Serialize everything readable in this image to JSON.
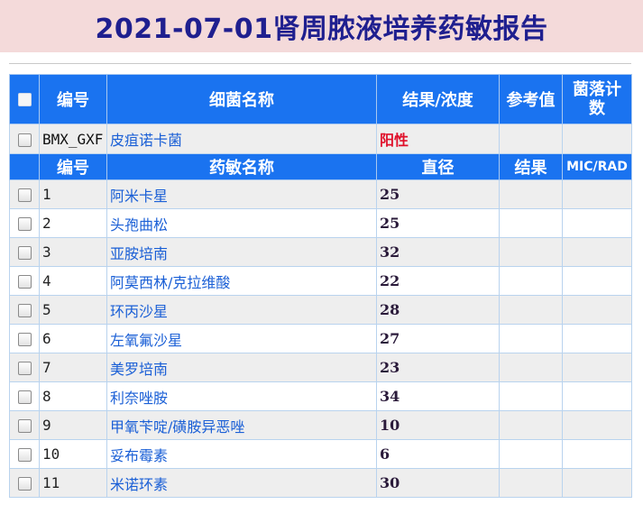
{
  "title": "2021-07-01肾周脓液培养药敏报告",
  "header": {
    "no": "编号",
    "bacteria_name": "细菌名称",
    "result_conc": "结果/浓度",
    "reference": "参考值",
    "colony_count": "菌落计数"
  },
  "bacteria": {
    "code": "BMX_GXF",
    "name": "皮疽诺卡菌",
    "result": "阳性"
  },
  "subheader": {
    "no": "编号",
    "drug_name": "药敏名称",
    "diameter": "直径",
    "result": "结果",
    "mic": "MIC/RAD"
  },
  "drugs": [
    {
      "no": "1",
      "name": "阿米卡星",
      "diameter": "25",
      "result": "",
      "mic": ""
    },
    {
      "no": "2",
      "name": "头孢曲松",
      "diameter": "25",
      "result": "",
      "mic": ""
    },
    {
      "no": "3",
      "name": "亚胺培南",
      "diameter": "32",
      "result": "",
      "mic": ""
    },
    {
      "no": "4",
      "name": "阿莫西林/克拉维酸",
      "diameter": "22",
      "result": "",
      "mic": ""
    },
    {
      "no": "5",
      "name": "环丙沙星",
      "diameter": "28",
      "result": "",
      "mic": ""
    },
    {
      "no": "6",
      "name": "左氧氟沙星",
      "diameter": "27",
      "result": "",
      "mic": ""
    },
    {
      "no": "7",
      "name": "美罗培南",
      "diameter": "23",
      "result": "",
      "mic": ""
    },
    {
      "no": "8",
      "name": "利奈唑胺",
      "diameter": "34",
      "result": "",
      "mic": ""
    },
    {
      "no": "9",
      "name": "甲氧苄啶/磺胺异恶唑",
      "diameter": "10",
      "result": "",
      "mic": ""
    },
    {
      "no": "10",
      "name": "妥布霉素",
      "diameter": "6",
      "result": "",
      "mic": ""
    },
    {
      "no": "11",
      "name": "米诺环素",
      "diameter": "30",
      "result": "",
      "mic": ""
    }
  ],
  "colors": {
    "title_bg": "#f4dada",
    "title_text": "#1f1f8f",
    "header_bg": "#1a73f0",
    "link": "#1a5fd6",
    "positive": "#e0102a"
  }
}
